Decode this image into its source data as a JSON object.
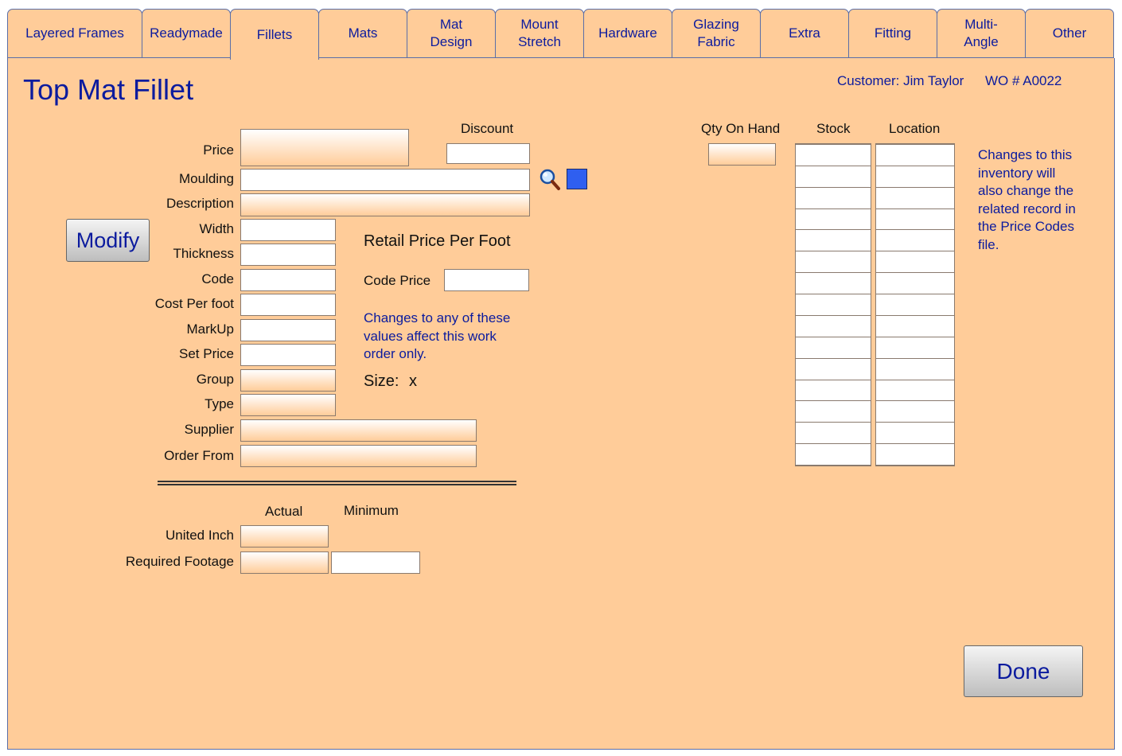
{
  "tabs": [
    {
      "label": "Layered Frames"
    },
    {
      "label": "Readymade"
    },
    {
      "label": "Fillets"
    },
    {
      "label": "Mats"
    },
    {
      "label": "Mat\nDesign"
    },
    {
      "label": "Mount\nStretch"
    },
    {
      "label": "Hardware"
    },
    {
      "label": "Glazing\nFabric"
    },
    {
      "label": "Extra"
    },
    {
      "label": "Fitting"
    },
    {
      "label": "Multi-\nAngle"
    },
    {
      "label": "Other"
    }
  ],
  "active_tab": "Fillets",
  "page": {
    "title": "Top Mat Fillet",
    "customer": "Customer: Jim Taylor",
    "work_order": "WO # A0022"
  },
  "form": {
    "discount_label": "Discount",
    "labels": {
      "price": "Price",
      "moulding": "Moulding",
      "description": "Description",
      "width": "Width",
      "thickness": "Thickness",
      "code": "Code",
      "cost_per_foot": "Cost Per foot",
      "markup": "MarkUp",
      "set_price": "Set Price",
      "group": "Group",
      "type": "Type",
      "supplier": "Supplier",
      "order_from": "Order From"
    },
    "values": {
      "price": "",
      "discount": "",
      "moulding": "",
      "description": "",
      "width": "",
      "thickness": "",
      "code": "",
      "cost_per_foot": "",
      "markup": "",
      "set_price": "",
      "group": "",
      "type": "",
      "supplier": "",
      "order_from": "",
      "code_price": ""
    },
    "retail_heading": "Retail Price Per Foot",
    "code_price_label": "Code Price",
    "note": "Changes to any of these values affect this work order only.",
    "size_label": "Size:",
    "size_value": "x"
  },
  "footage": {
    "actual_header": "Actual",
    "minimum_header": "Minimum",
    "united_inch_label": "United Inch",
    "required_footage_label": "Required Footage",
    "united_inch_actual": "",
    "required_footage_actual": "",
    "required_footage_minimum": ""
  },
  "inventory": {
    "qty_label": "Qty On Hand",
    "stock_label": "Stock",
    "location_label": "Location",
    "qty_value": "",
    "rows": [
      "",
      "",
      "",
      "",
      "",
      "",
      "",
      "",
      "",
      "",
      "",
      "",
      "",
      "",
      ""
    ],
    "note": "Changes to this inventory will also change the related record in the Price Codes file."
  },
  "buttons": {
    "modify": "Modify",
    "done": "Done"
  },
  "icons": {
    "search": "magnifier-icon",
    "swatch": "color-swatch-icon",
    "swatch_color": "#2f5ff0"
  }
}
